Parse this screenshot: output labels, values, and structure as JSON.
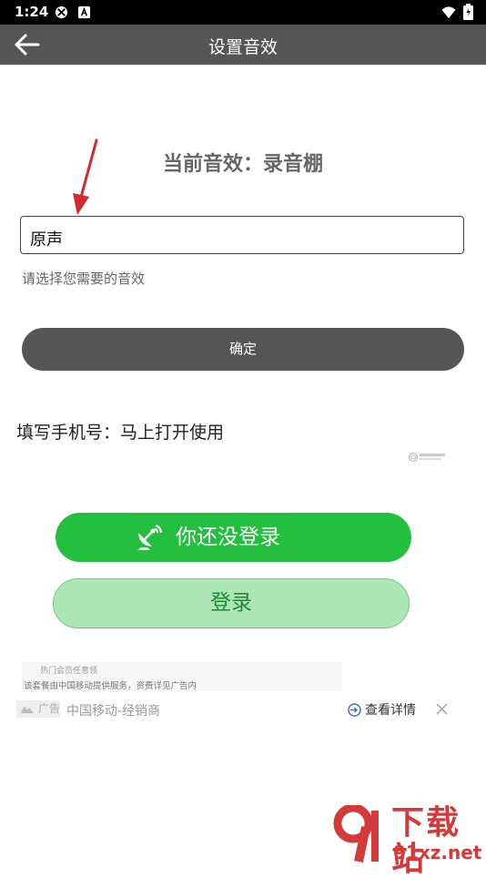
{
  "status_bar": {
    "time": "1:24"
  },
  "app_bar": {
    "title": "设置音效"
  },
  "effect": {
    "current_label": "当前音效：录音棚",
    "selected_value": "原声",
    "hint": "请选择您需要的音效",
    "confirm_label": "确定"
  },
  "phone": {
    "prompt": "填写手机号：马上打开使用"
  },
  "login_panel": {
    "not_logged_label": "你还没登录",
    "login_label": "登录"
  },
  "ad": {
    "hot_label": "热门会员任意领",
    "description": "该套餐由中国移动提供服务，资费详见广告内",
    "tag": "广告",
    "source": "中国移动-经销商",
    "detail_label": "查看详情"
  },
  "watermark": {
    "title": "下载站",
    "domain": "91xz.net"
  },
  "colors": {
    "app_bar": "#555555",
    "confirm_button": "#555555",
    "not_logged_button": "#22c03e",
    "login_button": "#ade6b5",
    "annotation_arrow": "#d42a2a",
    "watermark": "#d43a3a"
  },
  "icons": [
    "signal-off-icon",
    "keyboard-a-icon",
    "wifi-icon",
    "battery-icon",
    "back-arrow-icon",
    "satellite-dish-icon",
    "china-mobile-logo",
    "ad-mark-icon",
    "login-arrow-icon",
    "close-icon"
  ]
}
